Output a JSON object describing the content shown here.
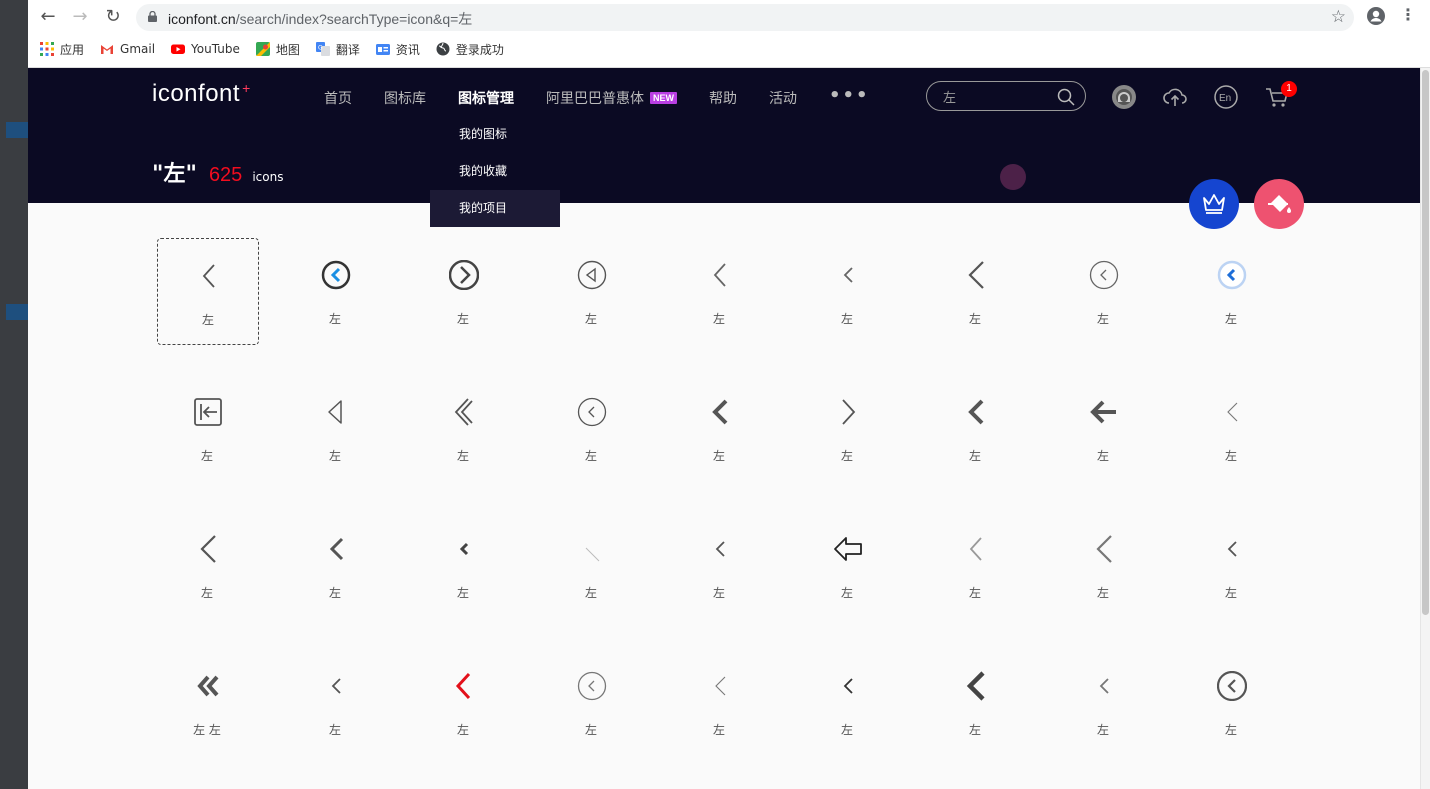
{
  "browser": {
    "url_host": "iconfont.cn",
    "url_path": "/search/index?searchType=icon&q=左",
    "bookmarks": [
      {
        "label": "应用",
        "icon": "apps-grid-icon"
      },
      {
        "label": "Gmail",
        "icon": "gmail-icon"
      },
      {
        "label": "YouTube",
        "icon": "youtube-icon"
      },
      {
        "label": "地图",
        "icon": "maps-icon"
      },
      {
        "label": "翻译",
        "icon": "translate-icon"
      },
      {
        "label": "资讯",
        "icon": "news-icon"
      },
      {
        "label": "登录成功",
        "icon": "globe-icon"
      }
    ]
  },
  "site": {
    "logo": "iconfont",
    "logo_plus": "+",
    "menu": [
      {
        "label": "首页"
      },
      {
        "label": "图标库"
      },
      {
        "label": "图标管理"
      },
      {
        "label": "阿里巴巴普惠体",
        "badge": "NEW"
      },
      {
        "label": "帮助"
      },
      {
        "label": "活动"
      }
    ],
    "more": "•••",
    "dropdown": [
      "我的图标",
      "我的收藏",
      "我的项目"
    ],
    "search_value": "左",
    "cart_count": "1",
    "lang_label": "En",
    "result_query": "\"左\"",
    "result_count": "625",
    "result_unit": "icons"
  },
  "icons": [
    {
      "label": "左",
      "shape": "chev-thin",
      "color": "#555"
    },
    {
      "label": "左",
      "shape": "circle-chev-blue",
      "color": "#1a8fe3"
    },
    {
      "label": "左",
      "shape": "circle-chev-right-bold",
      "color": "#444"
    },
    {
      "label": "左",
      "shape": "circle-tri",
      "color": "#555"
    },
    {
      "label": "左",
      "shape": "chev-thin",
      "color": "#666"
    },
    {
      "label": "左",
      "shape": "chev-small",
      "color": "#666"
    },
    {
      "label": "左",
      "shape": "chev-thin-large",
      "color": "#555"
    },
    {
      "label": "左",
      "shape": "circle-chev-thin",
      "color": "#666"
    },
    {
      "label": "左",
      "shape": "circle-chev-light-blue",
      "color": "#1d6ed8"
    },
    {
      "label": "左",
      "shape": "box-arrow",
      "color": "#555"
    },
    {
      "label": "左",
      "shape": "tri-outline",
      "color": "#555"
    },
    {
      "label": "左",
      "shape": "double-line-chev",
      "color": "#555"
    },
    {
      "label": "左",
      "shape": "circle-chev-thin",
      "color": "#555"
    },
    {
      "label": "左",
      "shape": "chev-bold",
      "color": "#555"
    },
    {
      "label": "左",
      "shape": "chev-right-thin",
      "color": "#555"
    },
    {
      "label": "左",
      "shape": "chev-bold",
      "color": "#555"
    },
    {
      "label": "左",
      "shape": "arrow-bold",
      "color": "#555"
    },
    {
      "label": "左",
      "shape": "chev-hair",
      "color": "#777"
    },
    {
      "label": "左",
      "shape": "chev-thin-large",
      "color": "#555"
    },
    {
      "label": "左",
      "shape": "chev-medium",
      "color": "#555"
    },
    {
      "label": "左",
      "shape": "chev-tiny-bold",
      "color": "#444"
    },
    {
      "label": "左",
      "shape": "slash",
      "color": "#bbb"
    },
    {
      "label": "左",
      "shape": "chev-small",
      "color": "#555"
    },
    {
      "label": "左",
      "shape": "arrow-outline",
      "color": "#222"
    },
    {
      "label": "左",
      "shape": "chev-thin",
      "color": "#999"
    },
    {
      "label": "左",
      "shape": "chev-thin-large",
      "color": "#777"
    },
    {
      "label": "左",
      "shape": "chev-small",
      "color": "#555"
    },
    {
      "label": "左 左",
      "shape": "double-chev",
      "color": "#555"
    },
    {
      "label": "左",
      "shape": "chev-small",
      "color": "#555"
    },
    {
      "label": "左",
      "shape": "chev-red",
      "color": "#e3101a"
    },
    {
      "label": "左",
      "shape": "circle-chev-thin",
      "color": "#777"
    },
    {
      "label": "左",
      "shape": "chev-hair",
      "color": "#777"
    },
    {
      "label": "左",
      "shape": "chev-small",
      "color": "#333"
    },
    {
      "label": "左",
      "shape": "chev-bold-large",
      "color": "#444"
    },
    {
      "label": "左",
      "shape": "chev-small",
      "color": "#777"
    },
    {
      "label": "左",
      "shape": "circle-chev-bold",
      "color": "#555"
    }
  ]
}
